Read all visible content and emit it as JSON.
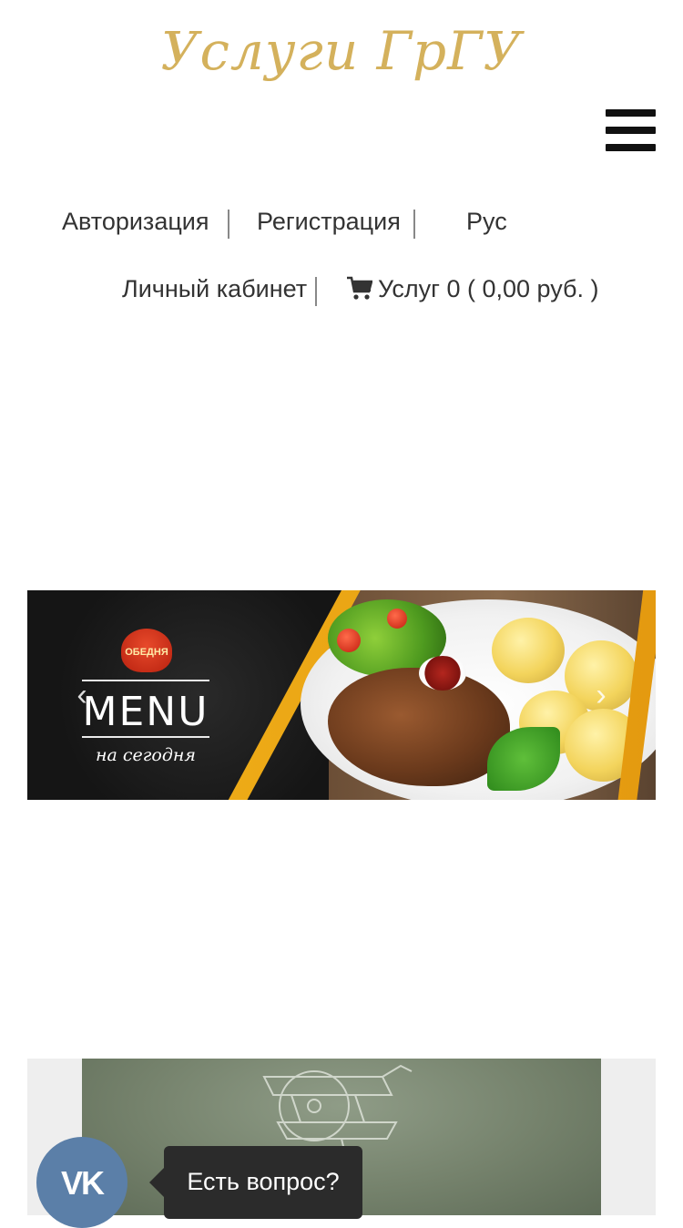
{
  "header": {
    "logo_text": "Услуги ГрГУ",
    "menu_icon": "hamburger-menu-icon"
  },
  "nav": {
    "login": "Авторизация",
    "register": "Регистрация",
    "language": "Рус",
    "account": "Личный кабинет",
    "cart": {
      "icon": "shopping-cart-icon",
      "label": "Услуг 0 ( 0,00 руб. )"
    }
  },
  "banner": {
    "brand_badge": "ОБЕДНЯ",
    "title": "MENU",
    "subtitle": "на сегодня",
    "prev_icon": "chevron-left-icon",
    "next_icon": "chevron-right-icon"
  },
  "chat_widget": {
    "icon": "vk-icon",
    "vk_label": "VK",
    "tooltip": "Есть вопрос?"
  },
  "colors": {
    "logo_gold": "#d4b15c",
    "vk_blue": "#5b7fa8",
    "tooltip_bg": "#2b2b2b"
  }
}
